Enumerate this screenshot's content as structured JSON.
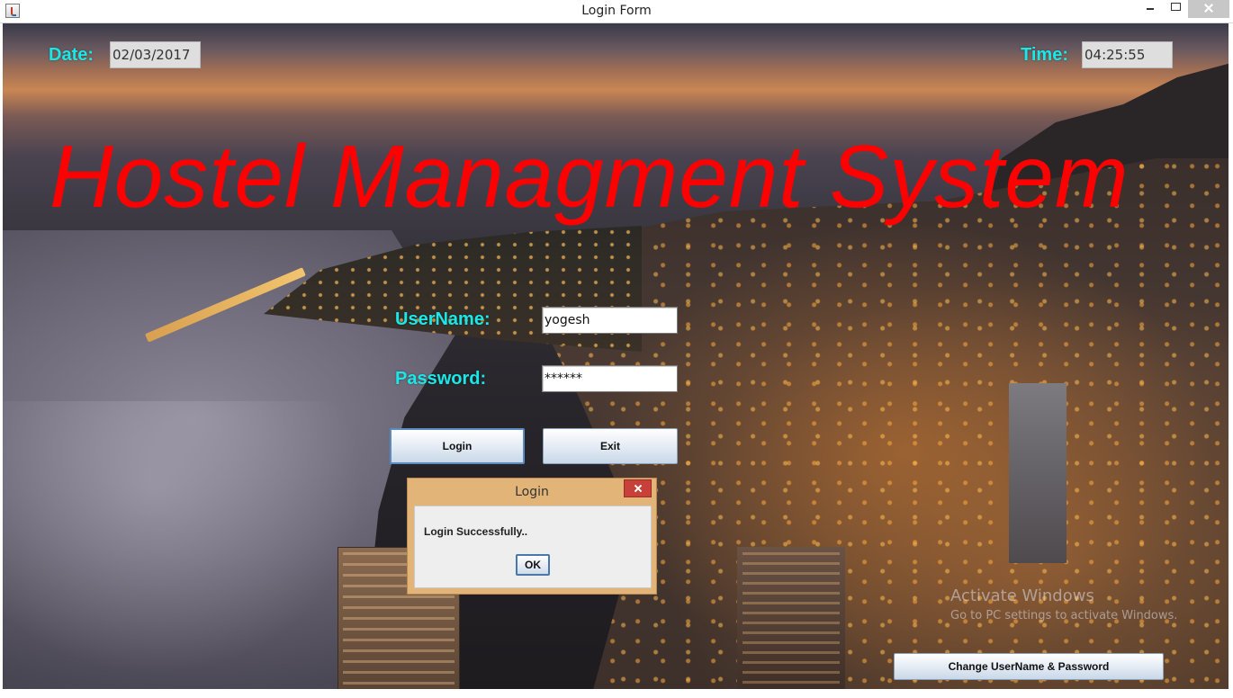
{
  "window": {
    "title": "Login Form",
    "icon": "java-icon"
  },
  "header": {
    "date_label": "Date:",
    "date_value": "02/03/2017",
    "time_label": "Time:",
    "time_value": "04:25:55"
  },
  "app_title": "Hostel Managment System",
  "form": {
    "username_label": "UserName:",
    "username_value": "yogesh",
    "password_label": "Password:",
    "password_value": "******",
    "login_label": "Login",
    "exit_label": "Exit"
  },
  "dialog": {
    "title": "Login",
    "message": "Login Successfully..",
    "ok_label": "OK"
  },
  "footer": {
    "change_button_label": "Change UserName & Password"
  },
  "watermark": {
    "line1": "Activate Windows",
    "line2": "Go to PC settings to activate Windows."
  },
  "colors": {
    "title_red": "#ff0000",
    "label_cyan": "#19e8e8",
    "dialog_frame": "#e2b478"
  }
}
